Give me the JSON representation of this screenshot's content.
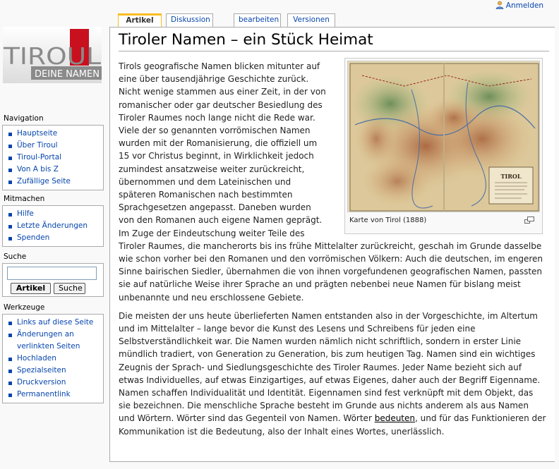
{
  "personal": {
    "login_label": "Anmelden"
  },
  "tabs": [
    {
      "label": "Artikel",
      "selected": true
    },
    {
      "label": "Diskussion",
      "selected": false
    },
    {
      "label": "bearbeiten",
      "selected": false
    },
    {
      "label": "Versionen",
      "selected": false
    }
  ],
  "logo": {
    "line1": "TIROUL",
    "line2": "DEINE NAMEN"
  },
  "navigation": {
    "title": "Navigation",
    "items": [
      "Hauptseite",
      "Über Tiroul",
      "Tiroul-Portal",
      "Von A bis Z",
      "Zufällige Seite"
    ]
  },
  "participate": {
    "title": "Mitmachen",
    "items": [
      "Hilfe",
      "Letzte Änderungen",
      "Spenden"
    ]
  },
  "search": {
    "title": "Suche",
    "value": "",
    "go_label": "Artikel",
    "search_label": "Suche"
  },
  "toolbox": {
    "title": "Werkzeuge",
    "items": [
      "Links auf diese Seite",
      "Änderungen an verlinkten Seiten",
      "Hochladen",
      "Spezialseiten",
      "Druckversion",
      "Permanentlink"
    ]
  },
  "article": {
    "title": "Tiroler Namen – ein Stück Heimat",
    "paragraph1": "Tirols geografische Namen blicken mitunter auf eine über tausendjährige Geschichte zurück. Nicht wenige stammen aus einer Zeit, in der von romanischer oder gar deutscher Besiedlung des Tiroler Raumes noch lange nicht die Rede war. Viele der so genannten vorrömischen Namen wurden mit der Romanisierung, die offiziell um 15 vor Christus beginnt, in Wirklichkeit jedoch zumindest ansatzweise weiter zurückreicht, übernommen und dem Lateinischen und späteren Romanischen nach bestimmten Sprachgesetzen angepasst. Daneben wurden von den Romanen auch eigene Namen geprägt. Im Zuge der Eindeutschung weiter Teile des Tiroler Raumes, die mancherorts bis ins frühe Mittelalter zurückreicht, geschah im Grunde dasselbe wie schon vorher bei den Romanen und den vorrömischen Völkern: Auch die deutschen, im engeren Sinne bairischen Siedler, übernahmen die von ihnen vorgefundenen geografischen Namen, passten sie auf natürliche Weise ihrer Sprache an und prägten nebenbei neue Namen für bislang meist unbenannte und neu erschlossene Gebiete.",
    "paragraph2_before_link": "Die meisten der uns heute überlieferten Namen entstanden also in der Vorgeschichte, im Altertum und im Mittelalter – lange bevor die Kunst des Lesens und Schreibens für jeden eine Selbstverständlichkeit war. Die Namen wurden nämlich nicht schriftlich, sondern in erster Linie mündlich tradiert, von Generation zu Generation, bis zum heutigen Tag. Namen sind ein wichtiges Zeugnis der Sprach- und Siedlungsgeschichte des Tiroler Raumes. Jeder Name bezieht sich auf etwas Individuelles, auf etwas Einzigartiges, auf etwas Eigenes, daher auch der Begriff Eigenname. Namen schaffen Individualität und Identität. Eigennamen sind fest verknüpft mit dem Objekt, das sie bezeichnen. Die menschliche Sprache besteht im Grunde aus nichts anderem als aus Namen und Wörtern. Wörter sind das Gegenteil von Namen. Wörter ",
    "paragraph2_link": "bedeuten",
    "paragraph2_after_link": ", und für das Funktionieren der Kommunikation ist die Bedeutung, also der Inhalt eines Wortes, unerlässlich.",
    "thumb_caption": "Karte von Tirol (1888)",
    "map_title": "TIROL"
  }
}
